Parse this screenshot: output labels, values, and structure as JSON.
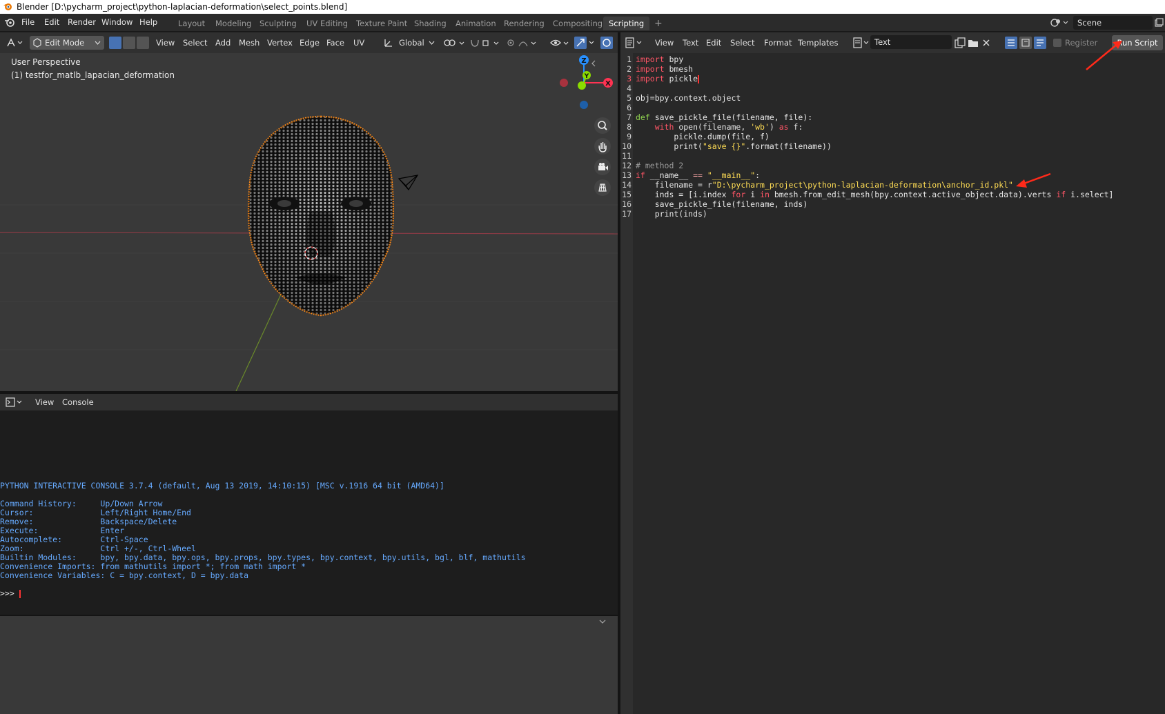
{
  "window": {
    "title": "Blender [D:\\pycharm_project\\python-laplacian-deformation\\select_points.blend]"
  },
  "topbar": {
    "menus": [
      "File",
      "Edit",
      "Render",
      "Window",
      "Help"
    ],
    "workspaces": [
      "Layout",
      "Modeling",
      "Sculpting",
      "UV Editing",
      "Texture Paint",
      "Shading",
      "Animation",
      "Rendering",
      "Compositing",
      "Scripting"
    ],
    "active_workspace": "Scripting",
    "add_tab": "+",
    "scene": "Scene"
  },
  "viewport": {
    "mode": "Edit Mode",
    "menus": [
      "View",
      "Select",
      "Add",
      "Mesh",
      "Vertex",
      "Edge",
      "Face",
      "UV"
    ],
    "orientation": "Global",
    "perspective": "User Perspective",
    "object": "(1) testfor_matlb_lapacian_deformation",
    "gizmo": {
      "x": "X",
      "y": "Y",
      "z": "Z"
    },
    "colors": {
      "x_axis": "#ff3352",
      "y_axis": "#8bdc00",
      "z_axis": "#2890ff",
      "selection": "#ff8c1a"
    }
  },
  "console": {
    "menus": [
      "View",
      "Console"
    ],
    "lines": [
      "PYTHON INTERACTIVE CONSOLE 3.7.4 (default, Aug 13 2019, 14:10:15) [MSC v.1916 64 bit (AMD64)]",
      "",
      "Command History:     Up/Down Arrow",
      "Cursor:              Left/Right Home/End",
      "Remove:              Backspace/Delete",
      "Execute:             Enter",
      "Autocomplete:        Ctrl-Space",
      "Zoom:                Ctrl +/-, Ctrl-Wheel",
      "Builtin Modules:     bpy, bpy.data, bpy.ops, bpy.props, bpy.types, bpy.context, bpy.utils, bgl, blf, mathutils",
      "Convenience Imports: from mathutils import *; from math import *",
      "Convenience Variables: C = bpy.context, D = bpy.data"
    ],
    "prompt": ">>> "
  },
  "editor": {
    "menus": [
      "View",
      "Text",
      "Edit",
      "Select",
      "Format",
      "Templates"
    ],
    "text_name": "Text",
    "register_label": "Register",
    "run_script_label": "Run Script",
    "line_numbers": [
      "1",
      "2",
      "3",
      "4",
      "5",
      "6",
      "7",
      "8",
      "9",
      "10",
      "11",
      "12",
      "13",
      "14",
      "15",
      "16",
      "17"
    ],
    "code": {
      "l1_kw": "import",
      "l1_rest": " bpy",
      "l2_kw": "import",
      "l2_rest": " bmesh",
      "l3_kw": "import",
      "l3_rest": " pickle",
      "l5": "obj=bpy.context.object",
      "l7_kw": "def",
      "l7_rest": " save_pickle_file(filename, file):",
      "l8_pre": "    ",
      "l8_kw": "with",
      "l8_a": " open(filename, ",
      "l8_str": "'wb'",
      "l8_b": ") ",
      "l8_kw2": "as",
      "l8_c": " f:",
      "l9": "        pickle.dump(file, f)",
      "l10_a": "        print(",
      "l10_str": "\"save {}\"",
      "l10_b": ".format(filename))",
      "l12": "# method 2",
      "l13_kw": "if",
      "l13_a": " __name__ ",
      "l13_op": "==",
      "l13_b": " ",
      "l13_str": "\"__main__\"",
      "l13_c": ":",
      "l14_a": "    filename = r",
      "l14_str": "\"D:\\pycharm_project\\python-laplacian-deformation\\anchor_id.pkl\"",
      "l15_a": "    inds = [i.index ",
      "l15_kw": "for",
      "l15_b": " i ",
      "l15_kw2": "in",
      "l15_c": " bmesh.from_edit_mesh(bpy.context.active_object.data).verts ",
      "l15_kw3": "if",
      "l15_d": " i.select]",
      "l16": "    save_pickle_file(filename, inds)",
      "l17": "    print(inds)"
    }
  }
}
